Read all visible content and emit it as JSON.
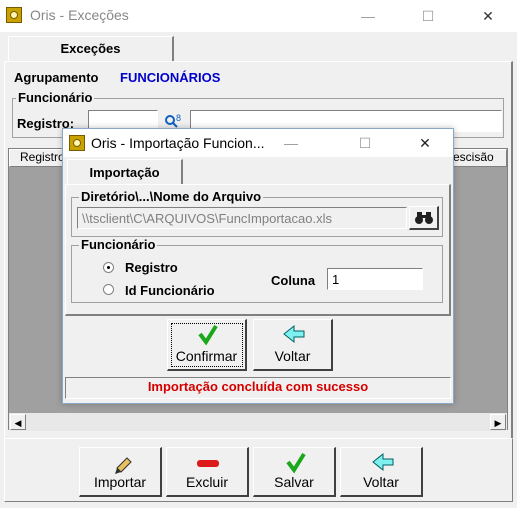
{
  "window": {
    "title": "Oris - Exceções",
    "minimize": "—",
    "maximize": "☐",
    "close": "✕"
  },
  "main": {
    "tab_label": "Exceções",
    "agrupamento_label": "Agrupamento",
    "agrupamento_value": "FUNCIONÁRIOS",
    "funcionario_group": "Funcionário",
    "registro_label": "Registro:",
    "grid_col_registro": "Registro",
    "grid_col_rescisao": "escisão"
  },
  "toolbar": {
    "importar": "Importar",
    "excluir": "Excluir",
    "salvar": "Salvar",
    "voltar": "Voltar"
  },
  "dialog": {
    "title": "Oris - Importação Funcion...",
    "tab_label": "Importação",
    "dir_group": "Diretório\\...\\Nome do Arquivo",
    "path_value": "\\\\tsclient\\C\\ARQUIVOS\\FuncImportacao.xls",
    "func_group": "Funcionário",
    "radio_registro": "Registro",
    "radio_id": "Id Funcionário",
    "coluna_label": "Coluna",
    "coluna_value": "1",
    "confirmar": "Confirmar",
    "voltar": "Voltar",
    "status": "Importação concluída com sucesso",
    "status_color": "#d40000"
  },
  "colors": {
    "accent_blue": "#0000cc",
    "icon_green": "#1aa81a",
    "icon_red": "#dd1a1a",
    "icon_cyan_arrow": "#00b0b0"
  }
}
